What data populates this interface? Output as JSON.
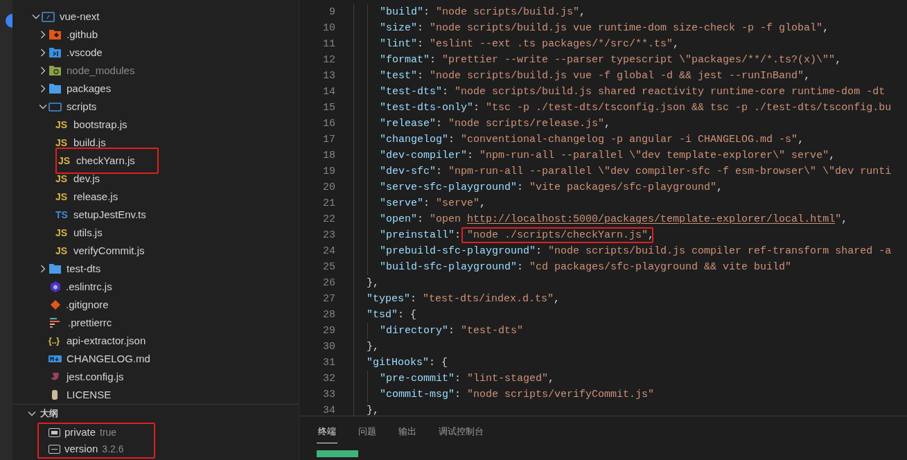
{
  "explorer": {
    "root": {
      "label": "vue-next",
      "kind": "root-folder",
      "expanded": true,
      "dimmed": false,
      "annotated": false,
      "children": [
        {
          "label": ".github",
          "kind": "github-folder",
          "expanded": false,
          "dimmed": false,
          "annotated": false
        },
        {
          "label": ".vscode",
          "kind": "vscode-folder",
          "expanded": false,
          "dimmed": false,
          "annotated": false
        },
        {
          "label": "node_modules",
          "kind": "node-folder",
          "expanded": false,
          "dimmed": true,
          "annotated": false
        },
        {
          "label": "packages",
          "kind": "folder",
          "expanded": false,
          "dimmed": false,
          "annotated": false
        },
        {
          "label": "scripts",
          "kind": "folder",
          "expanded": true,
          "dimmed": false,
          "annotated": false,
          "children": [
            {
              "label": "bootstrap.js",
              "kind": "js-file",
              "icon_text": "JS",
              "dimmed": false,
              "annotated": false
            },
            {
              "label": "build.js",
              "kind": "js-file",
              "icon_text": "JS",
              "dimmed": false,
              "annotated": false
            },
            {
              "label": "checkYarn.js",
              "kind": "js-file",
              "icon_text": "JS",
              "dimmed": false,
              "annotated": true
            },
            {
              "label": "dev.js",
              "kind": "js-file",
              "icon_text": "JS",
              "dimmed": false,
              "annotated": false
            },
            {
              "label": "release.js",
              "kind": "js-file",
              "icon_text": "JS",
              "dimmed": false,
              "annotated": false
            },
            {
              "label": "setupJestEnv.ts",
              "kind": "ts-file",
              "icon_text": "TS",
              "dimmed": false,
              "annotated": false
            },
            {
              "label": "utils.js",
              "kind": "js-file",
              "icon_text": "JS",
              "dimmed": false,
              "annotated": false
            },
            {
              "label": "verifyCommit.js",
              "kind": "js-file",
              "icon_text": "JS",
              "dimmed": false,
              "annotated": false
            }
          ]
        },
        {
          "label": "test-dts",
          "kind": "folder",
          "expanded": false,
          "dimmed": false,
          "annotated": false
        },
        {
          "label": ".eslintrc.js",
          "kind": "eslint-file",
          "dimmed": false,
          "annotated": false
        },
        {
          "label": ".gitignore",
          "kind": "git-file",
          "dimmed": false,
          "annotated": false
        },
        {
          "label": ".prettierrc",
          "kind": "prettier-file",
          "dimmed": false,
          "annotated": false
        },
        {
          "label": "api-extractor.json",
          "kind": "json-file",
          "icon_text": "{..}",
          "dimmed": false,
          "annotated": false
        },
        {
          "label": "CHANGELOG.md",
          "kind": "markdown-file",
          "dimmed": false,
          "annotated": false
        },
        {
          "label": "jest.config.js",
          "kind": "jest-file",
          "dimmed": false,
          "annotated": false
        },
        {
          "label": "LICENSE",
          "kind": "license-file",
          "dimmed": false,
          "annotated": false
        }
      ]
    }
  },
  "outline": {
    "title": "大纲",
    "expanded": true,
    "annotated": true,
    "items": [
      {
        "name": "private",
        "value": "true",
        "kind": "boolean"
      },
      {
        "name": "version",
        "value": "3.2.6",
        "kind": "string"
      }
    ]
  },
  "editor": {
    "lines": [
      {
        "number": "9",
        "inner": true,
        "annotated": false,
        "tokens": [
          {
            "kind": "key",
            "text": "\"build\""
          },
          {
            "kind": "punct",
            "text": ": "
          },
          {
            "kind": "string",
            "text": "\"node scripts/build.js\""
          },
          {
            "kind": "punct",
            "text": ","
          }
        ]
      },
      {
        "number": "10",
        "inner": true,
        "annotated": false,
        "tokens": [
          {
            "kind": "key",
            "text": "\"size\""
          },
          {
            "kind": "punct",
            "text": ": "
          },
          {
            "kind": "string",
            "text": "\"node scripts/build.js vue runtime-dom size-check -p -f global\""
          },
          {
            "kind": "punct",
            "text": ","
          }
        ]
      },
      {
        "number": "11",
        "inner": true,
        "annotated": false,
        "tokens": [
          {
            "kind": "key",
            "text": "\"lint\""
          },
          {
            "kind": "punct",
            "text": ": "
          },
          {
            "kind": "string",
            "text": "\"eslint --ext .ts packages/*/src/**.ts\""
          },
          {
            "kind": "punct",
            "text": ","
          }
        ]
      },
      {
        "number": "12",
        "inner": true,
        "annotated": false,
        "tokens": [
          {
            "kind": "key",
            "text": "\"format\""
          },
          {
            "kind": "punct",
            "text": ": "
          },
          {
            "kind": "string",
            "text": "\"prettier --write --parser typescript \\\"packages/**/*.ts?(x)\\\"\""
          },
          {
            "kind": "punct",
            "text": ","
          }
        ]
      },
      {
        "number": "13",
        "inner": true,
        "annotated": false,
        "tokens": [
          {
            "kind": "key",
            "text": "\"test\""
          },
          {
            "kind": "punct",
            "text": ": "
          },
          {
            "kind": "string",
            "text": "\"node scripts/build.js vue -f global -d && jest --runInBand\""
          },
          {
            "kind": "punct",
            "text": ","
          }
        ]
      },
      {
        "number": "14",
        "inner": true,
        "annotated": false,
        "tokens": [
          {
            "kind": "key",
            "text": "\"test-dts\""
          },
          {
            "kind": "punct",
            "text": ": "
          },
          {
            "kind": "string",
            "text": "\"node scripts/build.js shared reactivity runtime-core runtime-dom -dt"
          }
        ]
      },
      {
        "number": "15",
        "inner": true,
        "annotated": false,
        "tokens": [
          {
            "kind": "key",
            "text": "\"test-dts-only\""
          },
          {
            "kind": "punct",
            "text": ": "
          },
          {
            "kind": "string",
            "text": "\"tsc -p ./test-dts/tsconfig.json && tsc -p ./test-dts/tsconfig.bu"
          }
        ]
      },
      {
        "number": "16",
        "inner": true,
        "annotated": false,
        "tokens": [
          {
            "kind": "key",
            "text": "\"release\""
          },
          {
            "kind": "punct",
            "text": ": "
          },
          {
            "kind": "string",
            "text": "\"node scripts/release.js\""
          },
          {
            "kind": "punct",
            "text": ","
          }
        ]
      },
      {
        "number": "17",
        "inner": true,
        "annotated": false,
        "tokens": [
          {
            "kind": "key",
            "text": "\"changelog\""
          },
          {
            "kind": "punct",
            "text": ": "
          },
          {
            "kind": "string",
            "text": "\"conventional-changelog -p angular -i CHANGELOG.md -s\""
          },
          {
            "kind": "punct",
            "text": ","
          }
        ]
      },
      {
        "number": "18",
        "inner": true,
        "annotated": false,
        "tokens": [
          {
            "kind": "key",
            "text": "\"dev-compiler\""
          },
          {
            "kind": "punct",
            "text": ": "
          },
          {
            "kind": "string",
            "text": "\"npm-run-all --parallel \\\"dev template-explorer\\\" serve\""
          },
          {
            "kind": "punct",
            "text": ","
          }
        ]
      },
      {
        "number": "19",
        "inner": true,
        "annotated": false,
        "tokens": [
          {
            "kind": "key",
            "text": "\"dev-sfc\""
          },
          {
            "kind": "punct",
            "text": ": "
          },
          {
            "kind": "string",
            "text": "\"npm-run-all --parallel \\\"dev compiler-sfc -f esm-browser\\\" \\\"dev runti"
          }
        ]
      },
      {
        "number": "20",
        "inner": true,
        "annotated": false,
        "tokens": [
          {
            "kind": "key",
            "text": "\"serve-sfc-playground\""
          },
          {
            "kind": "punct",
            "text": ": "
          },
          {
            "kind": "string",
            "text": "\"vite packages/sfc-playground\""
          },
          {
            "kind": "punct",
            "text": ","
          }
        ]
      },
      {
        "number": "21",
        "inner": true,
        "annotated": false,
        "tokens": [
          {
            "kind": "key",
            "text": "\"serve\""
          },
          {
            "kind": "punct",
            "text": ": "
          },
          {
            "kind": "string",
            "text": "\"serve\""
          },
          {
            "kind": "punct",
            "text": ","
          }
        ]
      },
      {
        "number": "22",
        "inner": true,
        "annotated": false,
        "tokens": [
          {
            "kind": "key",
            "text": "\"open\""
          },
          {
            "kind": "punct",
            "text": ": "
          },
          {
            "kind": "string",
            "text": "\"open "
          },
          {
            "kind": "link",
            "text": "http://localhost:5000/packages/template-explorer/local.html"
          },
          {
            "kind": "string",
            "text": "\""
          },
          {
            "kind": "punct",
            "text": ","
          }
        ]
      },
      {
        "number": "23",
        "inner": true,
        "annotated": true,
        "tokens": [
          {
            "kind": "key",
            "text": "\"preinstall\""
          },
          {
            "kind": "punct",
            "text": ": "
          },
          {
            "kind": "string",
            "text": "\"node ./scripts/checkYarn.js\""
          },
          {
            "kind": "punct",
            "text": ","
          }
        ]
      },
      {
        "number": "24",
        "inner": true,
        "annotated": false,
        "tokens": [
          {
            "kind": "key",
            "text": "\"prebuild-sfc-playground\""
          },
          {
            "kind": "punct",
            "text": ": "
          },
          {
            "kind": "string",
            "text": "\"node scripts/build.js compiler ref-transform shared -a"
          }
        ]
      },
      {
        "number": "25",
        "inner": true,
        "annotated": false,
        "tokens": [
          {
            "kind": "key",
            "text": "\"build-sfc-playground\""
          },
          {
            "kind": "punct",
            "text": ": "
          },
          {
            "kind": "string",
            "text": "\"cd packages/sfc-playground && vite build\""
          }
        ]
      },
      {
        "number": "26",
        "inner": false,
        "annotated": false,
        "tokens": [
          {
            "kind": "punct",
            "text": "},"
          }
        ]
      },
      {
        "number": "27",
        "inner": false,
        "annotated": false,
        "tokens": [
          {
            "kind": "key",
            "text": "\"types\""
          },
          {
            "kind": "punct",
            "text": ": "
          },
          {
            "kind": "string",
            "text": "\"test-dts/index.d.ts\""
          },
          {
            "kind": "punct",
            "text": ","
          }
        ]
      },
      {
        "number": "28",
        "inner": false,
        "annotated": false,
        "tokens": [
          {
            "kind": "key",
            "text": "\"tsd\""
          },
          {
            "kind": "punct",
            "text": ": {"
          }
        ]
      },
      {
        "number": "29",
        "inner": true,
        "annotated": false,
        "tokens": [
          {
            "kind": "key",
            "text": "\"directory\""
          },
          {
            "kind": "punct",
            "text": ": "
          },
          {
            "kind": "string",
            "text": "\"test-dts\""
          }
        ]
      },
      {
        "number": "30",
        "inner": false,
        "annotated": false,
        "tokens": [
          {
            "kind": "punct",
            "text": "},"
          }
        ]
      },
      {
        "number": "31",
        "inner": false,
        "annotated": false,
        "tokens": [
          {
            "kind": "key",
            "text": "\"gitHooks\""
          },
          {
            "kind": "punct",
            "text": ": {"
          }
        ]
      },
      {
        "number": "32",
        "inner": true,
        "annotated": false,
        "tokens": [
          {
            "kind": "key",
            "text": "\"pre-commit\""
          },
          {
            "kind": "punct",
            "text": ": "
          },
          {
            "kind": "string",
            "text": "\"lint-staged\""
          },
          {
            "kind": "punct",
            "text": ","
          }
        ]
      },
      {
        "number": "33",
        "inner": true,
        "annotated": false,
        "tokens": [
          {
            "kind": "key",
            "text": "\"commit-msg\""
          },
          {
            "kind": "punct",
            "text": ": "
          },
          {
            "kind": "string",
            "text": "\"node scripts/verifyCommit.js\""
          }
        ]
      },
      {
        "number": "34",
        "inner": false,
        "annotated": false,
        "tokens": [
          {
            "kind": "punct",
            "text": "},"
          }
        ]
      }
    ]
  },
  "panel": {
    "tabs": [
      {
        "label": "终端",
        "selected": true
      },
      {
        "label": "问题",
        "selected": false
      },
      {
        "label": "输出",
        "selected": false
      },
      {
        "label": "调试控制台",
        "selected": false
      }
    ]
  }
}
